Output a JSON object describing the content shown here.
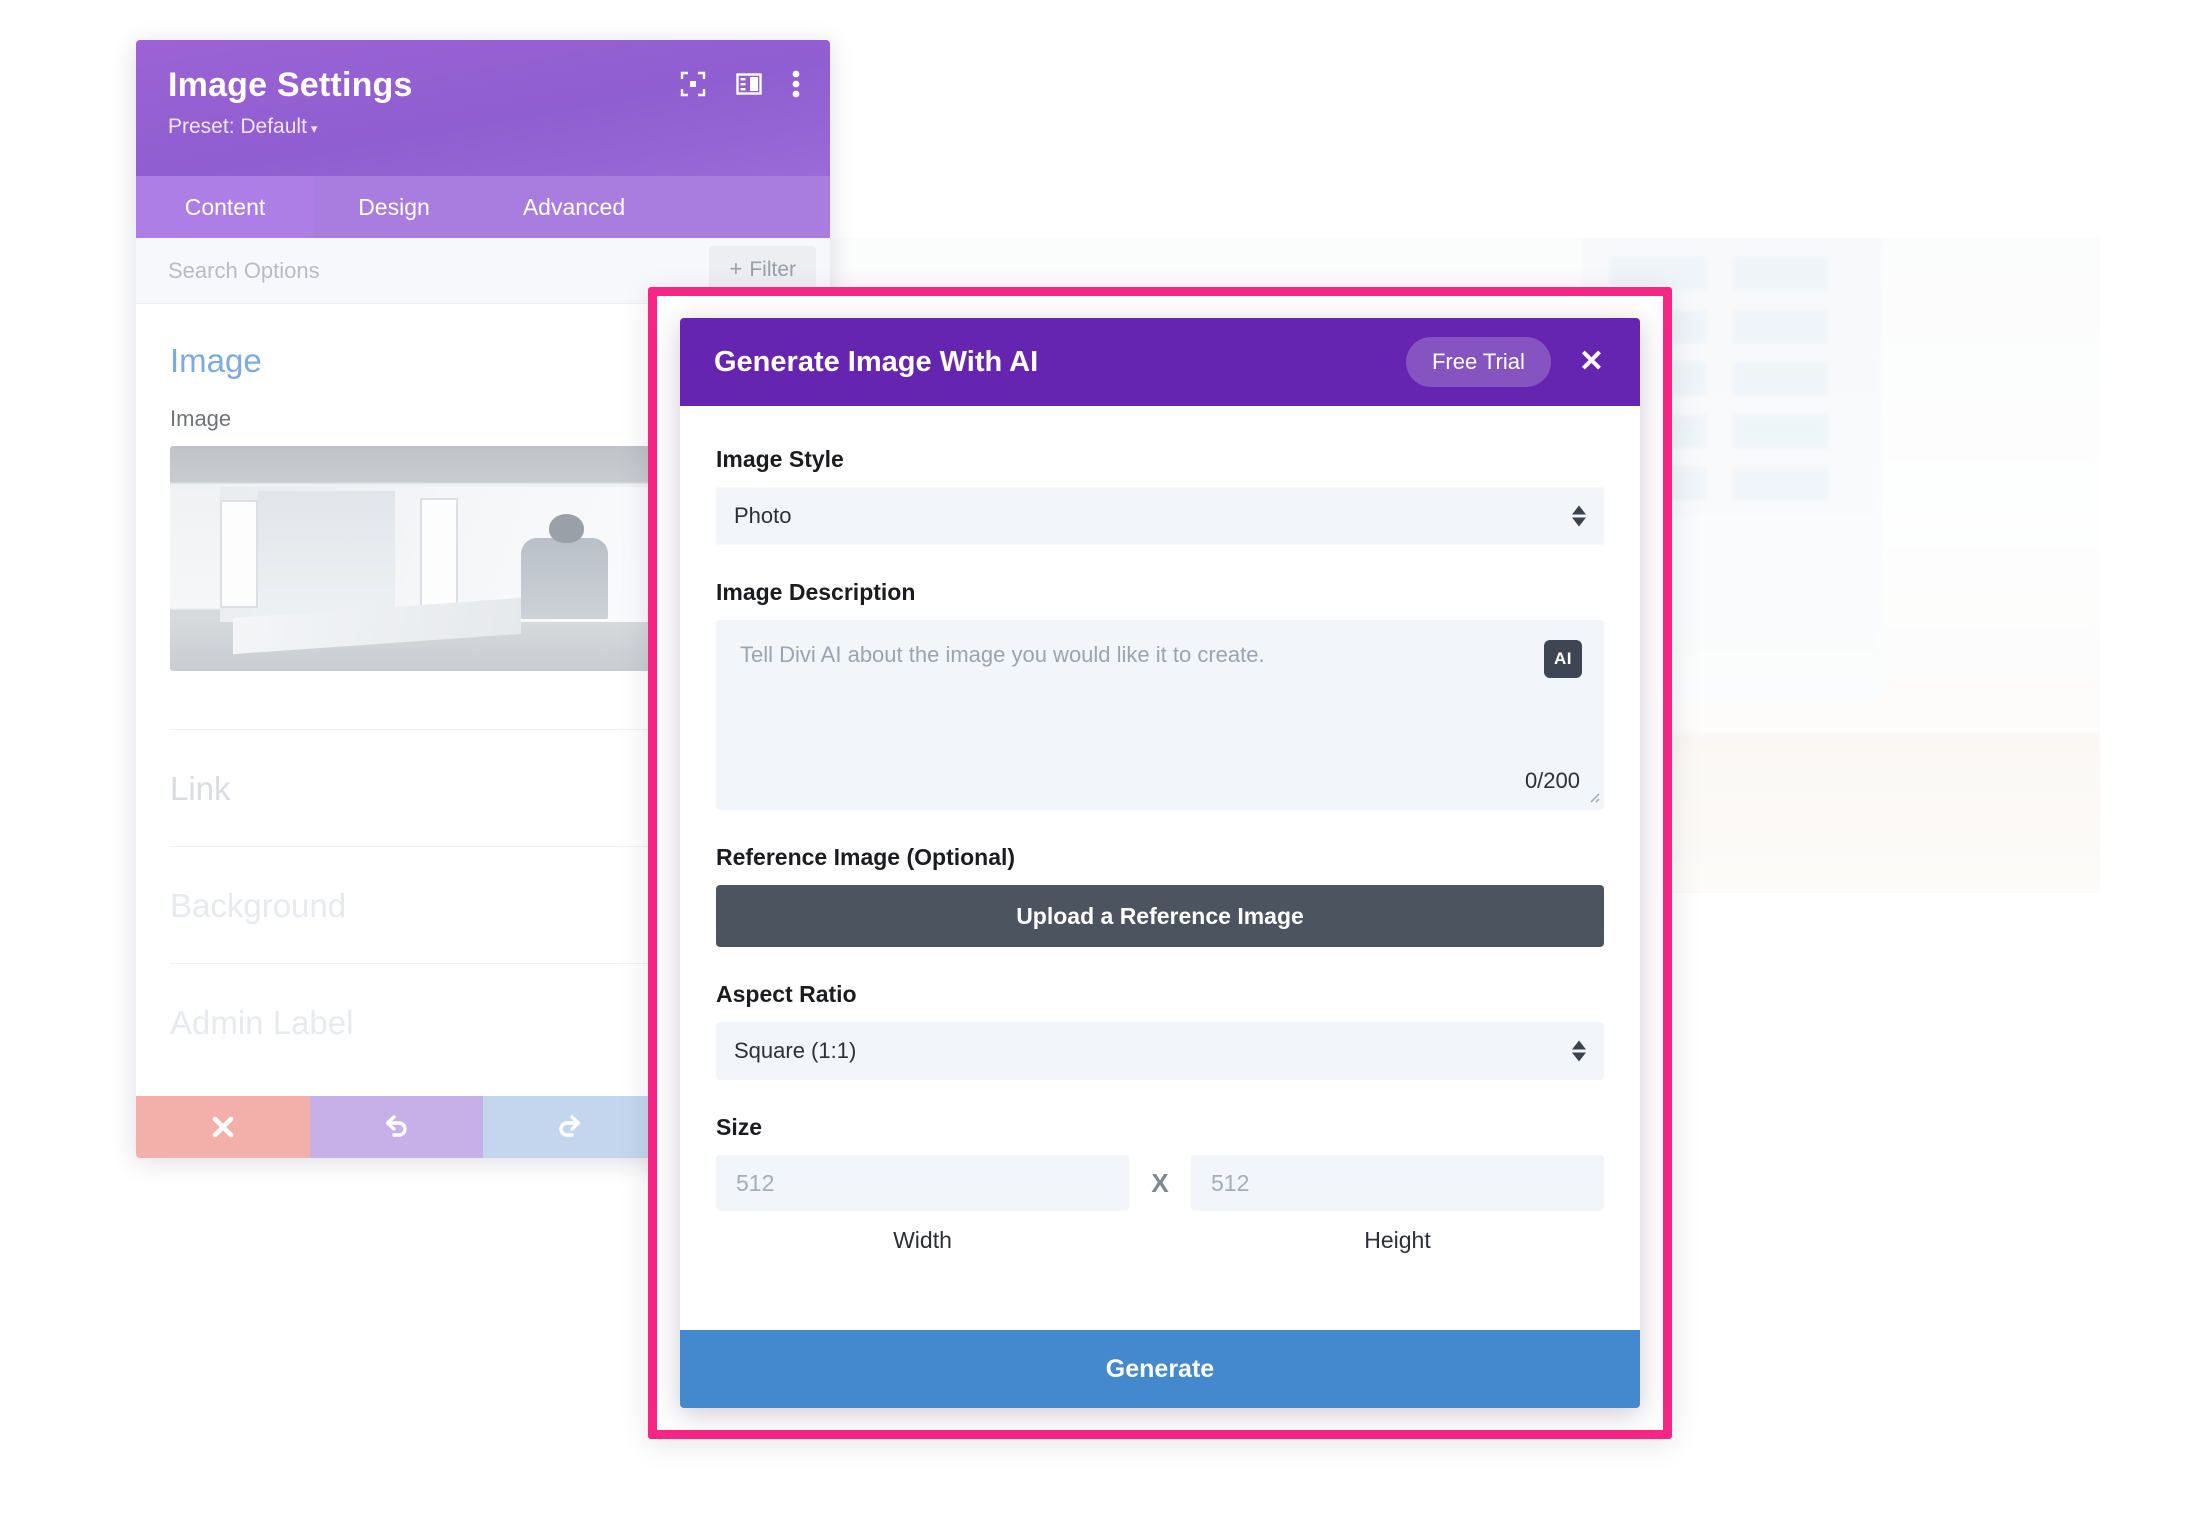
{
  "settings_panel": {
    "title": "Image Settings",
    "preset_label": "Preset: Default",
    "preset_caret": "▾",
    "header_icons": [
      "focus-target-icon",
      "layout-panel-icon",
      "more-vertical-icon"
    ],
    "tabs": [
      {
        "label": "Content",
        "active": true
      },
      {
        "label": "Design",
        "active": false
      },
      {
        "label": "Advanced",
        "active": false
      }
    ],
    "search": {
      "placeholder": "Search Options",
      "filter_label": "Filter",
      "filter_plus": "+"
    },
    "sections": {
      "image_heading": "Image",
      "image_field_label": "Image",
      "link_heading": "Link",
      "background_heading": "Background",
      "admin_label_heading": "Admin Label"
    },
    "footer_buttons": [
      {
        "name": "cancel",
        "icon": "close-icon"
      },
      {
        "name": "undo",
        "icon": "undo-icon"
      },
      {
        "name": "redo",
        "icon": "redo-icon"
      },
      {
        "name": "save",
        "icon": "check-icon"
      }
    ]
  },
  "ai_modal": {
    "title": "Generate Image With AI",
    "free_trial_label": "Free Trial",
    "close_label": "✕",
    "image_style": {
      "label": "Image Style",
      "value": "Photo"
    },
    "image_description": {
      "label": "Image Description",
      "placeholder": "Tell Divi AI about the image you would like it to create.",
      "badge": "AI",
      "counter": "0/200"
    },
    "reference_image": {
      "label": "Reference Image (Optional)",
      "button_label": "Upload a Reference Image"
    },
    "aspect_ratio": {
      "label": "Aspect Ratio",
      "value": "Square (1:1)"
    },
    "size": {
      "label": "Size",
      "width_placeholder": "512",
      "height_placeholder": "512",
      "separator": "X",
      "width_caption": "Width",
      "height_caption": "Height"
    },
    "generate_label": "Generate"
  },
  "colors": {
    "highlight_border": "#f72585",
    "modal_header": "#6525b0",
    "generate_button": "#4489ce",
    "upload_button": "#4c545f",
    "panel_header_purple": "#9b63d6",
    "section_heading_blue": "#7daae0"
  }
}
